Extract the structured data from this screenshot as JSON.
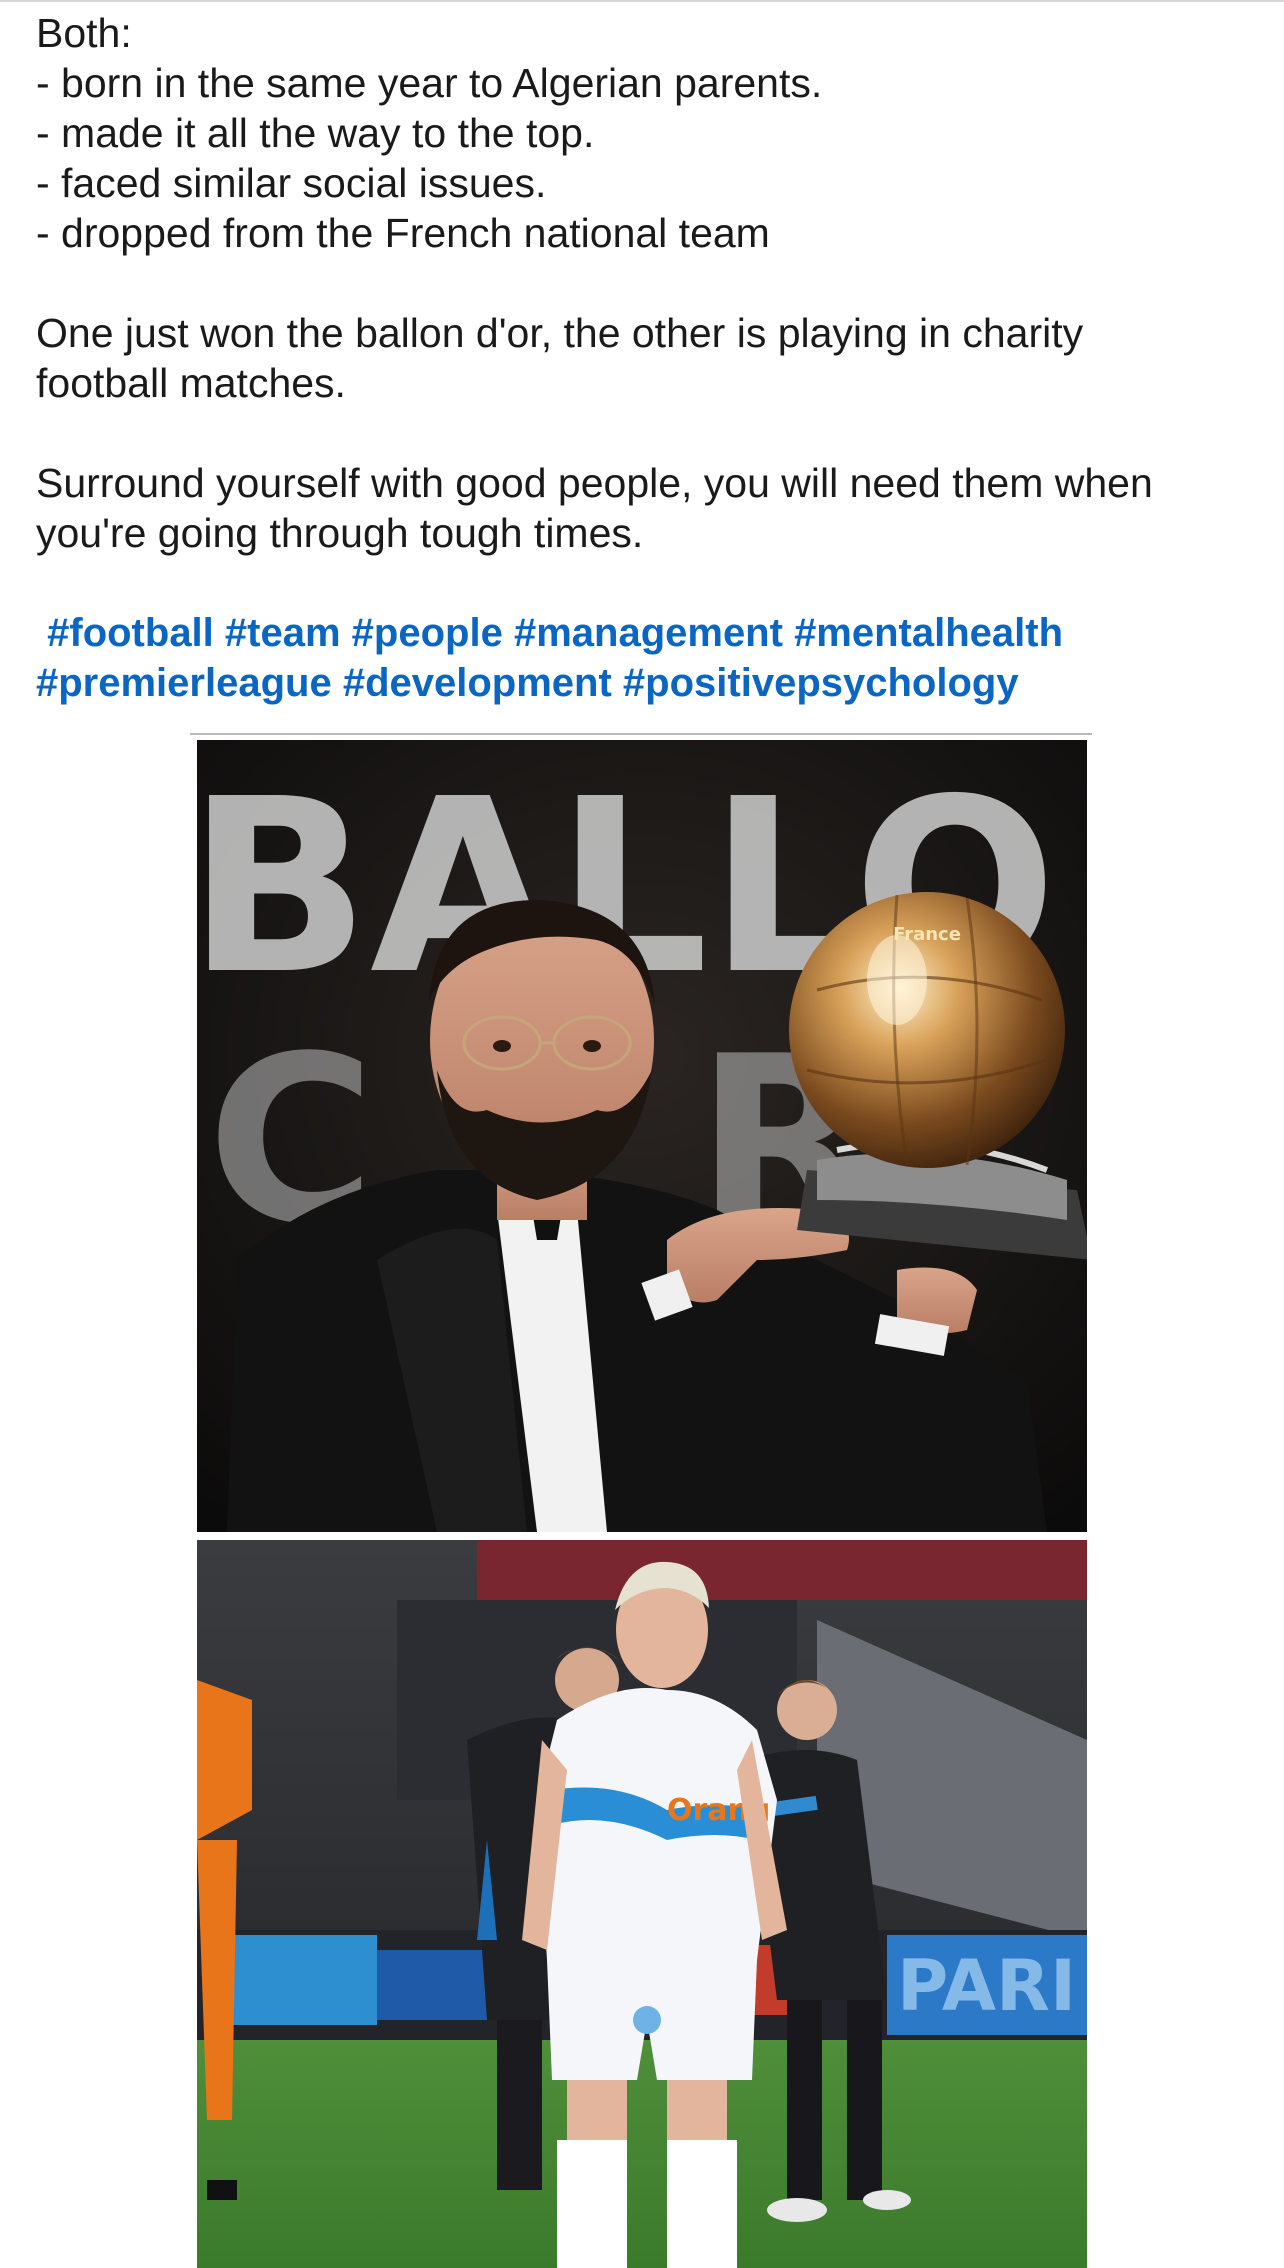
{
  "post": {
    "lines": [
      "Both:",
      "- born in the same year to Algerian parents.",
      "- made it all the way to the top.",
      "- faced similar social issues.",
      "- dropped from the French national team"
    ],
    "paragraph_2": [
      "One just won the ballon d'or, the other is playing in charity",
      "football matches."
    ],
    "paragraph_3": [
      "Surround yourself with good people,  you will need them when",
      "you're going through tough times."
    ],
    "hashtags_line_1": [
      "#football",
      "#team",
      "#people",
      "#management",
      "#mentalhealth"
    ],
    "hashtags_line_2": [
      "#premierleague",
      "#development",
      "#positivepsychology"
    ]
  },
  "images": {
    "photo_1": {
      "description_icon": "ballon-dor-ceremony-photo",
      "backdrop_text": "BALLO",
      "backdrop_text_2": "C R",
      "trophy_text": "France"
    },
    "photo_2": {
      "description_icon": "charity-football-match-photo",
      "sponsor_text": "Orang",
      "banner_text": "PARI"
    }
  },
  "colors": {
    "hashtag": "#0a66c2",
    "text": "#1a1a1a"
  }
}
